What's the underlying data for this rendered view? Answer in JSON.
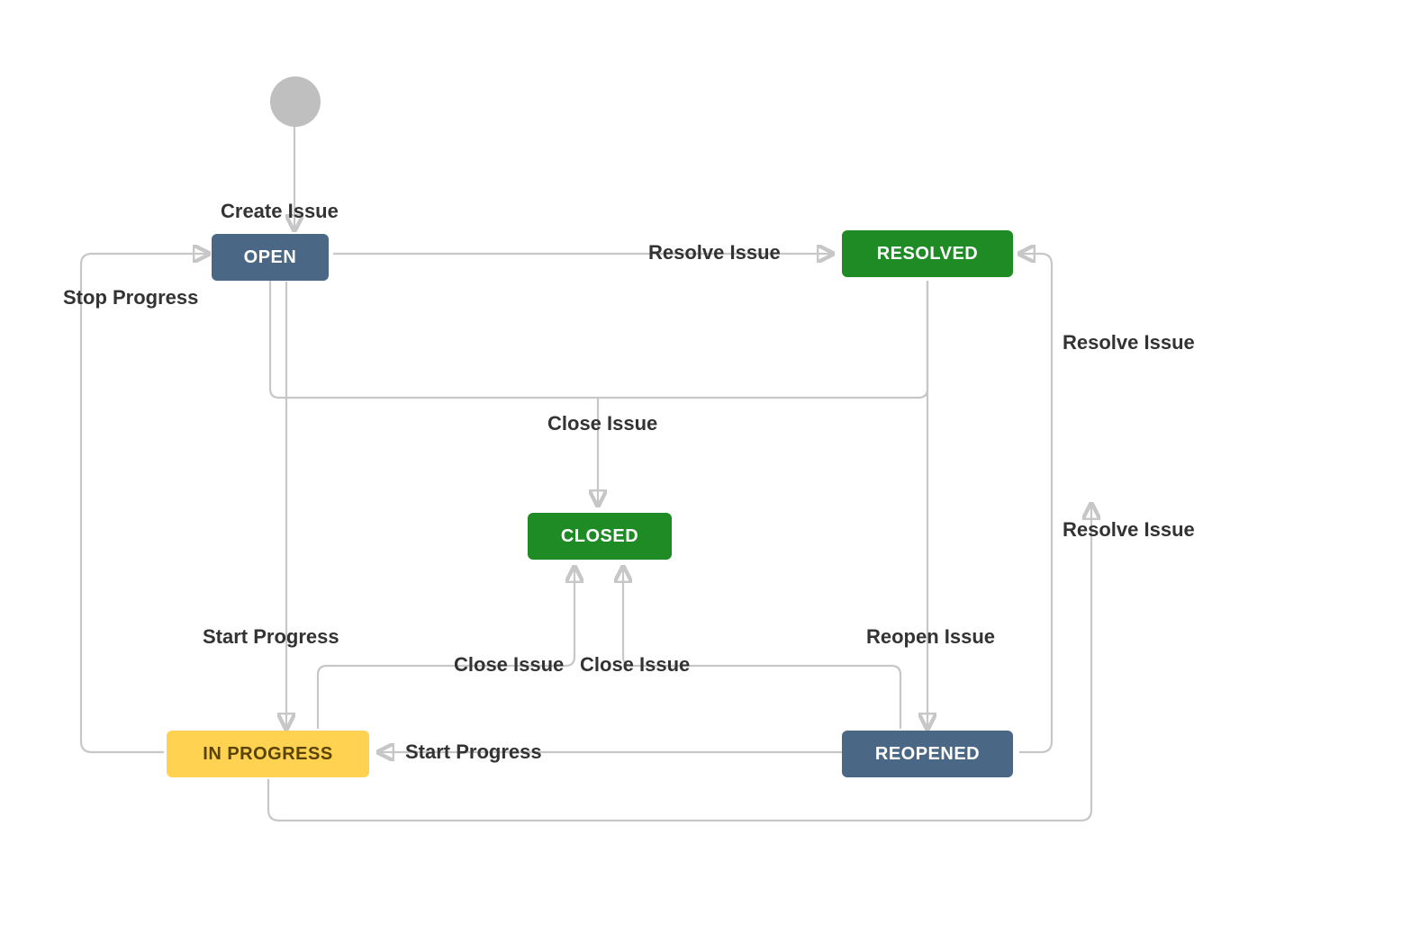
{
  "states": {
    "open": "OPEN",
    "resolved": "RESOLVED",
    "closed": "CLOSED",
    "in_progress": "IN PROGRESS",
    "reopened": "REOPENED"
  },
  "transitions": {
    "create_issue": "Create Issue",
    "resolve_issue_1": "Resolve Issue",
    "resolve_issue_2": "Resolve Issue",
    "resolve_issue_3": "Resolve Issue",
    "stop_progress": "Stop Progress",
    "close_issue_top": "Close Issue",
    "close_issue_left": "Close Issue",
    "close_issue_right": "Close Issue",
    "start_progress_1": "Start Progress",
    "start_progress_2": "Start Progress",
    "reopen_issue": "Reopen Issue"
  },
  "colors": {
    "node_blue": "#4a6785",
    "node_green": "#1f8b24",
    "node_yellow": "#ffd351",
    "edge": "#c7c7c7",
    "start": "#bfbfbf"
  }
}
